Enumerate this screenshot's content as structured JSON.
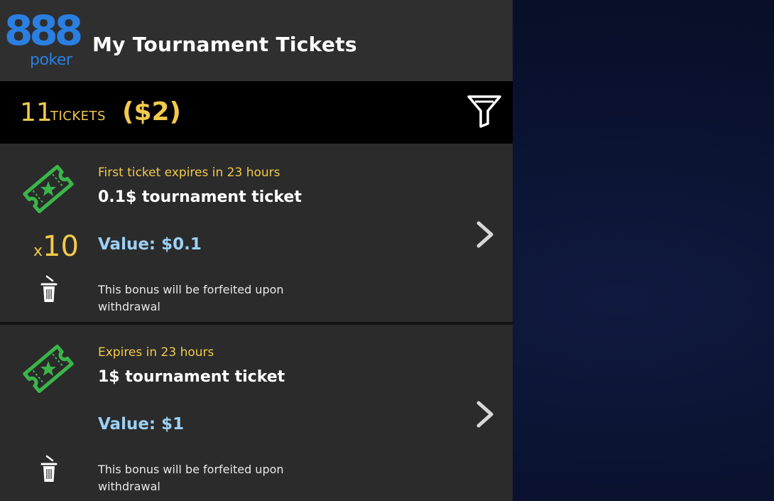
{
  "brand": {
    "logo_digits": "888",
    "logo_word": "poker",
    "color": "#2a7fe0"
  },
  "header": {
    "title": "My Tournament Tickets"
  },
  "summary": {
    "count": "11",
    "count_label": "TICKETS",
    "total_value": "($2)",
    "accent_color": "#f2c94c",
    "filter_icon": "filter-icon"
  },
  "tickets": [
    {
      "icon": "ticket-star-icon",
      "multiplier_prefix": "x",
      "multiplier_value": "10",
      "expiry": "First ticket expires in 23 hours",
      "name": "0.1$ tournament ticket",
      "value": "Value: $0.1",
      "notice": "This bonus will be forfeited upon withdrawal"
    },
    {
      "icon": "ticket-star-icon",
      "expiry": "Expires in 23 hours",
      "name": "1$ tournament ticket",
      "value": "Value: $1",
      "notice": "This bonus will be forfeited upon withdrawal"
    }
  ],
  "colors": {
    "ticket_green": "#3bb54a",
    "value_blue": "#9dd0f5"
  }
}
